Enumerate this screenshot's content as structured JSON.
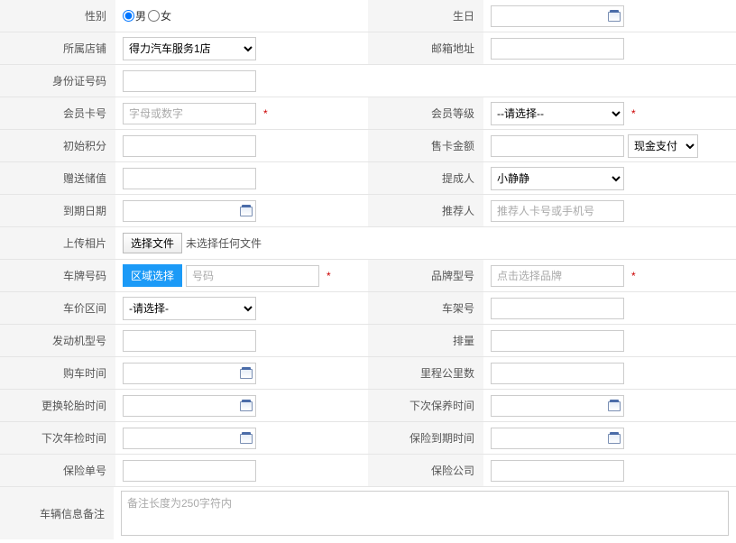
{
  "labels": {
    "gender": "性别",
    "birthday": "生日",
    "store": "所属店铺",
    "email": "邮箱地址",
    "idNumber": "身份证号码",
    "memberCard": "会员卡号",
    "memberLevel": "会员等级",
    "initPoints": "初始积分",
    "cardAmount": "售卡金额",
    "depositGift": "赠送储值",
    "promoter": "提成人",
    "expiry": "到期日期",
    "referrer": "推荐人",
    "uploadPhoto": "上传相片",
    "plateNumber": "车牌号码",
    "brandModel": "品牌型号",
    "priceRange": "车价区间",
    "vin": "车架号",
    "engineModel": "发动机型号",
    "displacement": "排量",
    "buyTime": "购车时间",
    "mileage": "里程公里数",
    "tireReplace": "更换轮胎时间",
    "nextService": "下次保养时间",
    "nextInspection": "下次年检时间",
    "insuranceExpiry": "保险到期时间",
    "insuranceNo": "保险单号",
    "insuranceCo": "保险公司",
    "vehicleNotes": "车辆信息备注"
  },
  "values": {
    "store": "得力汽车服务1店",
    "memberLevel": "--请选择--",
    "payMethod": "现金支付",
    "promoter": "小静静",
    "priceRange": "-请选择-"
  },
  "placeholders": {
    "memberCard": "字母或数字",
    "referrer": "推荐人卡号或手机号",
    "plateNumber": "号码",
    "brandModel": "点击选择品牌",
    "notes": "备注长度为250字符内"
  },
  "radio": {
    "male": "男",
    "female": "女"
  },
  "buttons": {
    "selectFile": "选择文件",
    "region": "区域选择"
  },
  "text": {
    "noFile": "未选择任何文件",
    "required": "*"
  }
}
